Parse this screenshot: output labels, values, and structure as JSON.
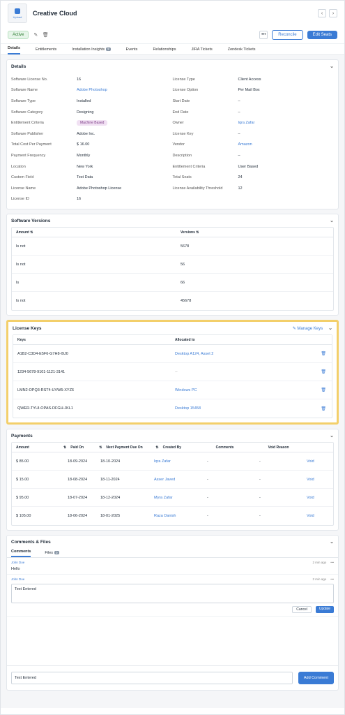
{
  "header": {
    "upload_label": "Upload",
    "title": "Creative Cloud"
  },
  "actions": {
    "status": "Active",
    "reconcile_label": "Reconcile",
    "edit_label": "Edit Seats"
  },
  "tabs": [
    {
      "label": "Details"
    },
    {
      "label": "Entitlements"
    },
    {
      "label": "Installation Insights",
      "count": "2"
    },
    {
      "label": "Events"
    },
    {
      "label": "Relationships"
    },
    {
      "label": "JIRA Tickets"
    },
    {
      "label": "Zendesk Tickets"
    }
  ],
  "details": {
    "title": "Details",
    "left": [
      {
        "k": "Software License No.",
        "v": "16"
      },
      {
        "k": "Software Name",
        "v": "Adobe Photoshop",
        "link": true
      },
      {
        "k": "Software Type",
        "v": "Installed"
      },
      {
        "k": "Software Category",
        "v": "Designing"
      },
      {
        "k": "Entitlement Criteria",
        "v": "Machine Based",
        "pill": true
      },
      {
        "k": "Software Publisher",
        "v": "Adobe Inc."
      },
      {
        "k": "Total Cost Per Payment",
        "v": "$ 16.00"
      },
      {
        "k": "Payment Frequency",
        "v": "Monthly"
      },
      {
        "k": "Location",
        "v": "New York"
      },
      {
        "k": "Custom Field",
        "v": "Test Data"
      },
      {
        "k": "License Name",
        "v": "Adobe Photoshop License"
      },
      {
        "k": "License ID",
        "v": "16"
      }
    ],
    "right": [
      {
        "k": "License Type",
        "v": "Client Access"
      },
      {
        "k": "License Option",
        "v": "Per Mail Box"
      },
      {
        "k": "Start Date",
        "v": "–"
      },
      {
        "k": "End Date",
        "v": "–"
      },
      {
        "k": "Owner",
        "v": "Iqra Zafar",
        "link": true
      },
      {
        "k": "License Key",
        "v": "–"
      },
      {
        "k": "Vendor",
        "v": "Amazon",
        "link": true
      },
      {
        "k": "Description",
        "v": "–"
      },
      {
        "k": "Entitlement Criteria",
        "v": "User Based"
      },
      {
        "k": "Total Seats",
        "v": "24"
      },
      {
        "k": "License Availability Threshold",
        "v": "12"
      }
    ]
  },
  "versions": {
    "title": "Software Versions",
    "col_amount": "Amount",
    "col_versions": "Versions",
    "rows": [
      {
        "amount": "Is not",
        "version": "5678"
      },
      {
        "amount": "Is not",
        "version": "56"
      },
      {
        "amount": "Is",
        "version": "66"
      },
      {
        "amount": "Is not",
        "version": "45678"
      }
    ]
  },
  "license_keys": {
    "title": "License Keys",
    "manage": "Manage Keys",
    "col_keys": "Keys",
    "col_alloc": "Allocated to",
    "rows": [
      {
        "key": "A1B2-C3D4-E5F6-G7H8-I9J0",
        "alloc": "Desktop A124, Asset 2"
      },
      {
        "key": "1234-5678-9101-1121-3141",
        "alloc": "--"
      },
      {
        "key": "LMN2-OPQ3-RST4-UVW5-XYZ6",
        "alloc": "Windows PC"
      },
      {
        "key": "QWER-TYUI-OPAS-DFGH-JKL1",
        "alloc": "Desktop 15458"
      }
    ]
  },
  "payments": {
    "title": "Payments",
    "cols": [
      "Amount",
      "Paid On",
      "Next Payment Due On",
      "Created By",
      "Comments",
      "Void Reason"
    ],
    "void_label": "Void",
    "rows": [
      {
        "amount": "$ 85.00",
        "paid": "18-09-2024",
        "next": "18-10-2024",
        "by": "Iqra Zafar",
        "comments": "-",
        "reason": "-"
      },
      {
        "amount": "$ 15.00",
        "paid": "18-08-2024",
        "next": "18-11-2024",
        "by": "Asser Javed",
        "comments": "-",
        "reason": "-"
      },
      {
        "amount": "$ 95.00",
        "paid": "18-07-2024",
        "next": "18-12-2024",
        "by": "Myra Zafar",
        "comments": "-",
        "reason": "-"
      },
      {
        "amount": "$ 105.00",
        "paid": "18-06-2024",
        "next": "18-01-2025",
        "by": "Raza Danish",
        "comments": "-",
        "reason": "-"
      }
    ]
  },
  "comments": {
    "title": "Comments & Files",
    "tab_comments": "Comments",
    "tab_files": "Files",
    "files_count": "0",
    "items": [
      {
        "author": "John Doe",
        "time": "2 min ago",
        "body": "Hello"
      },
      {
        "author": "John Doe",
        "time": "2 min ago",
        "body": "Text Entered"
      }
    ],
    "cancel": "Cancel",
    "update": "Update",
    "new_value": "Text Entered",
    "add": "Add Comment"
  }
}
